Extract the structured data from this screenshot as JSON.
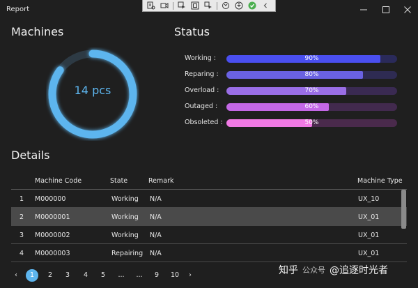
{
  "window": {
    "title": "Report"
  },
  "sections": {
    "machines_title": "Machines",
    "status_title": "Status",
    "details_title": "Details"
  },
  "machines": {
    "count_label": "14 pcs",
    "progress": 0.85,
    "ring_color": "#5db5ee"
  },
  "status": [
    {
      "label": "Working :",
      "value": 90,
      "text": "90%",
      "color": "#4a4ff0",
      "track": "#2a2a5a"
    },
    {
      "label": "Reparing :",
      "value": 80,
      "text": "80%",
      "color": "#6a62e2",
      "track": "#2e2b52"
    },
    {
      "label": "Overload :",
      "value": 70,
      "text": "70%",
      "color": "#9a6ee6",
      "track": "#3a2a52"
    },
    {
      "label": "Outaged :",
      "value": 60,
      "text": "60%",
      "color": "#c468e6",
      "track": "#422a4e"
    },
    {
      "label": "Obsoleted :",
      "value": 50,
      "text": "50%",
      "color": "#f07ae4",
      "track": "#4a2a4c"
    }
  ],
  "table": {
    "headers": {
      "code": "Machine Code",
      "state": "State",
      "remark": "Remark",
      "type": "Machine Type"
    },
    "rows": [
      {
        "index": "1",
        "code": "M000000",
        "state": "Working",
        "remark": "N/A",
        "type": "UX_10"
      },
      {
        "index": "2",
        "code": "M0000001",
        "state": "Working",
        "remark": "N/A",
        "type": "UX_01"
      },
      {
        "index": "3",
        "code": "M0000002",
        "state": "Working",
        "remark": "N/A",
        "type": "UX_01"
      },
      {
        "index": "4",
        "code": "M0000003",
        "state": "Repairing",
        "remark": "N/A",
        "type": "UX_01"
      }
    ]
  },
  "pager": {
    "prev": "‹",
    "pages": [
      "1",
      "2",
      "3",
      "4",
      "5",
      "...",
      "...",
      "9",
      "10"
    ],
    "next": "›",
    "current": "1"
  },
  "watermark": {
    "brand": "知乎",
    "sub": "公众号",
    "account": "@追逐时光者"
  }
}
